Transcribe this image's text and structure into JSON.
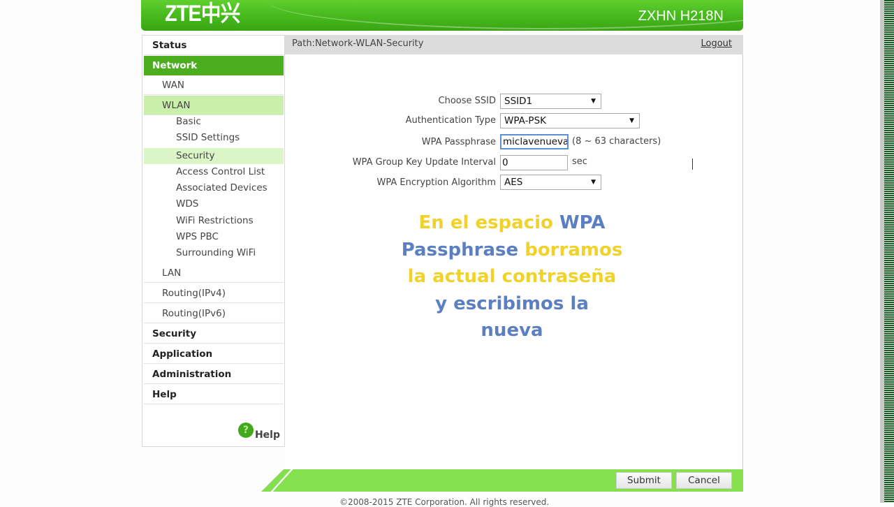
{
  "header": {
    "logo": "ZTE中兴",
    "model": "ZXHN H218N"
  },
  "pathbar": {
    "path": "Path:Network-WLAN-Security",
    "logout": "Logout"
  },
  "sidebar": {
    "items": [
      {
        "label": "Status",
        "level": 0,
        "active": false
      },
      {
        "label": "Network",
        "level": 0,
        "active": true
      },
      {
        "label": "WAN",
        "level": 1,
        "active": false
      },
      {
        "label": "WLAN",
        "level": 1,
        "active": true
      },
      {
        "label": "Basic",
        "level": 2,
        "active": false
      },
      {
        "label": "SSID Settings",
        "level": 2,
        "active": false
      },
      {
        "label": "Security",
        "level": 2,
        "active": true
      },
      {
        "label": "Access Control List",
        "level": 2,
        "active": false
      },
      {
        "label": "Associated Devices",
        "level": 2,
        "active": false
      },
      {
        "label": "WDS",
        "level": 2,
        "active": false
      },
      {
        "label": "WiFi Restrictions",
        "level": 2,
        "active": false
      },
      {
        "label": "WPS PBC",
        "level": 2,
        "active": false
      },
      {
        "label": "Surrounding WiFi",
        "level": 2,
        "active": false
      },
      {
        "label": "LAN",
        "level": 1,
        "active": false
      },
      {
        "label": "Routing(IPv4)",
        "level": 1,
        "active": false
      },
      {
        "label": "Routing(IPv6)",
        "level": 1,
        "active": false
      },
      {
        "label": "Security",
        "level": 0,
        "active": false
      },
      {
        "label": "Application",
        "level": 0,
        "active": false
      },
      {
        "label": "Administration",
        "level": 0,
        "active": false
      },
      {
        "label": "Help",
        "level": 0,
        "active": false
      }
    ],
    "help_link": "Help",
    "help_icon": "?"
  },
  "form": {
    "ssid": {
      "label": "Choose SSID",
      "value": "SSID1"
    },
    "auth_type": {
      "label": "Authentication Type",
      "value": "WPA-PSK"
    },
    "passphrase": {
      "label": "WPA Passphrase",
      "value": "miclavenueva",
      "hint": "(8 ~ 63 characters)"
    },
    "group_key": {
      "label": "WPA Group Key Update Interval",
      "value": "0",
      "unit": "sec"
    },
    "encryption": {
      "label": "WPA Encryption Algorithm",
      "value": "AES"
    }
  },
  "caption": {
    "parts": [
      {
        "text": "En el espacio ",
        "color": "yellow"
      },
      {
        "text": "WPA Passphrase",
        "color": "blue"
      },
      {
        "text": " borramos la actual contraseña ",
        "color": "yellow"
      },
      {
        "text": "y escribimos la nueva",
        "color": "blue"
      }
    ],
    "line1a": "En el espacio",
    "line1b": "WPA",
    "line2a": "Passphrase",
    "line2b": "borramos",
    "line3": "la actual contraseña",
    "line4": "y escribimos la",
    "line5": "nueva"
  },
  "footer": {
    "submit": "Submit",
    "cancel": "Cancel",
    "copyright": "©2008-2015 ZTE Corporation. All rights reserved."
  },
  "colors": {
    "brand_green": "#4cae1f",
    "header_green": "#46b81c",
    "footer_green": "#84e04e",
    "caption_yellow": "#f0d22a",
    "caption_blue": "#5b7fc0"
  }
}
